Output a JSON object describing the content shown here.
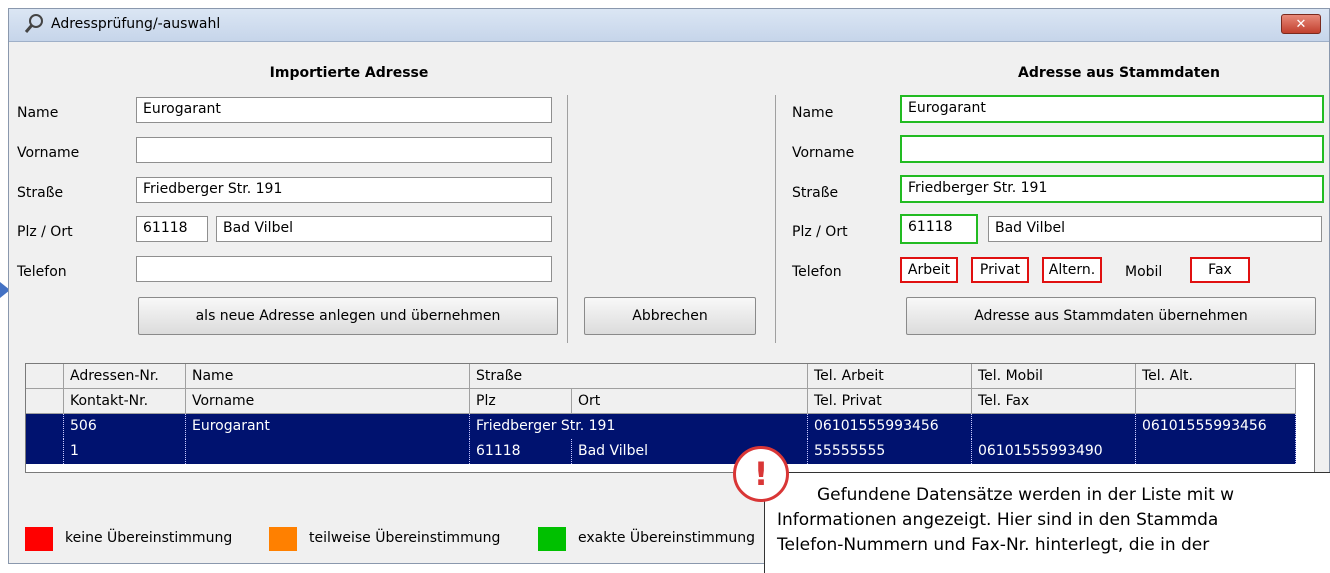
{
  "window": {
    "title": "Adressprüfung/-auswahl",
    "close_label": "✕"
  },
  "imported": {
    "title": "Importierte Adresse",
    "labels": {
      "name": "Name",
      "vorname": "Vorname",
      "strasse": "Straße",
      "plz_ort": "Plz / Ort",
      "telefon": "Telefon"
    },
    "values": {
      "name": "Eurogarant",
      "vorname": "",
      "strasse": "Friedberger Str. 191",
      "plz": "61118",
      "ort": "Bad Vilbel",
      "telefon": ""
    }
  },
  "master": {
    "title": "Adresse aus Stammdaten",
    "labels": {
      "name": "Name",
      "vorname": "Vorname",
      "strasse": "Straße",
      "plz_ort": "Plz / Ort",
      "telefon": "Telefon"
    },
    "values": {
      "name": "Eurogarant",
      "vorname": "",
      "strasse": "Friedberger Str. 191",
      "plz": "61118",
      "ort": "Bad Vilbel"
    },
    "phone_tags": {
      "arbeit": "Arbeit",
      "privat": "Privat",
      "altern": "Altern.",
      "mobil": "Mobil",
      "fax": "Fax"
    }
  },
  "buttons": {
    "new_address": "als neue Adresse anlegen und übernehmen",
    "cancel": "Abbrechen",
    "take_master": "Adresse aus Stammdaten übernehmen"
  },
  "grid": {
    "header1": [
      "Adressen-Nr.",
      "Name",
      "Straße",
      "Tel. Arbeit",
      "Tel. Mobil",
      "Tel. Alt."
    ],
    "header2": [
      "Kontakt-Nr.",
      "Vorname",
      "Plz",
      "Ort",
      "Tel. Privat",
      "Tel. Fax",
      ""
    ],
    "row1": [
      "506",
      "Eurogarant",
      "Friedberger Str. 191",
      "06101555993456",
      "",
      "06101555993456"
    ],
    "row2": [
      "1",
      "",
      "61118",
      "Bad Vilbel",
      "55555555",
      "06101555993490",
      ""
    ]
  },
  "legend": {
    "none": {
      "label": "keine Übereinstimmung",
      "color": "#ff0000"
    },
    "partial": {
      "label": "teilweise Übereinstimmung",
      "color": "#ff8000"
    },
    "exact": {
      "label": "exakte Übereinstimmung",
      "color": "#00c000"
    }
  },
  "callout": {
    "icon": "!",
    "line1": "Gefundene Datensätze werden in der Liste mit w",
    "line2": "Informationen angezeigt. Hier sind in den Stammda",
    "line3": "Telefon-Nummern und Fax-Nr. hinterlegt, die in der"
  },
  "colors": {
    "exact": "#22bb22",
    "none": "#e01010",
    "selection": "#00126f",
    "callout_accent": "#d93636"
  }
}
